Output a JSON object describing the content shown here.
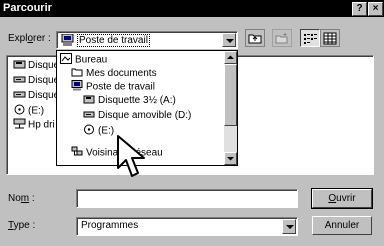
{
  "window": {
    "title": "Parcourir",
    "help_button": "?",
    "close_button": "×"
  },
  "explorer": {
    "label_prefix": "Expl",
    "label_accel": "o",
    "label_suffix": "rer :",
    "selected": "Poste de travail"
  },
  "file_list": {
    "items": [
      {
        "label": "Disque",
        "icon": "floppy-icon"
      },
      {
        "label": "Disque",
        "icon": "drive-icon"
      },
      {
        "label": "Disque",
        "icon": "drive-icon"
      },
      {
        "label": "(E:)",
        "icon": "cdrom-icon"
      },
      {
        "label": "Hp dri",
        "icon": "network-drive-icon"
      }
    ]
  },
  "dropdown": {
    "items": [
      {
        "label": "Bureau",
        "icon": "desktop-icon"
      },
      {
        "label": "Mes documents",
        "icon": "folder-icon"
      },
      {
        "label": "Poste de travail",
        "icon": "computer-icon"
      },
      {
        "label": "Disquette 3½ (A:)",
        "icon": "floppy-icon"
      },
      {
        "label": "Disque amovible (D:)",
        "icon": "drive-icon"
      },
      {
        "label": "(E:)",
        "icon": "cdrom-icon"
      },
      {
        "label": "Voisinage réseau",
        "icon": "network-icon"
      }
    ]
  },
  "name_field": {
    "label_prefix": "No",
    "label_accel": "m",
    "label_suffix": " :",
    "value": ""
  },
  "type_field": {
    "label_accel": "T",
    "label_suffix": "ype :",
    "selected": "Programmes"
  },
  "buttons": {
    "open_accel": "O",
    "open_suffix": "uvrir",
    "cancel": "Annuler"
  }
}
